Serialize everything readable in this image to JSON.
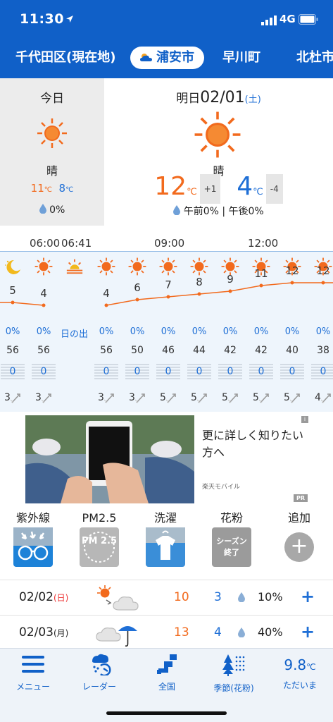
{
  "status_bar": {
    "time": "11:30",
    "network": "4G"
  },
  "tabs": [
    {
      "label": "千代田区(現在地)",
      "active": false
    },
    {
      "label": "浦安市",
      "active": true
    },
    {
      "label": "早川町",
      "active": false
    },
    {
      "label": "北杜市",
      "active": false
    }
  ],
  "today": {
    "label": "今日",
    "weather": "晴",
    "high": "11",
    "low": "8",
    "unit": "℃",
    "precip": "0%"
  },
  "tomorrow": {
    "label_prefix": "明日",
    "date": "02/01",
    "weekday": "(土)",
    "weather": "晴",
    "high": "12",
    "low": "4",
    "unit": "℃",
    "high_diff": "+1",
    "low_diff": "-4",
    "precip": "午前0% | 午後0%"
  },
  "hourly": {
    "time_labels": [
      "06:00",
      "06:41",
      "09:00",
      "12:00"
    ],
    "sunrise_label": "日の出",
    "columns": [
      {
        "icon": "moon-icon",
        "temp": "5",
        "precip": "0%",
        "humidity": "56",
        "rain": "0",
        "wind": "3"
      },
      {
        "icon": "sun-icon",
        "temp": "4",
        "precip": "0%",
        "humidity": "56",
        "rain": "0",
        "wind": "3"
      },
      {
        "icon": "sunrise-icon",
        "temp": "",
        "precip": "",
        "humidity": "",
        "rain": "",
        "wind": ""
      },
      {
        "icon": "sun-icon",
        "temp": "4",
        "precip": "0%",
        "humidity": "56",
        "rain": "0",
        "wind": "3"
      },
      {
        "icon": "sun-icon",
        "temp": "6",
        "precip": "0%",
        "humidity": "50",
        "rain": "0",
        "wind": "3"
      },
      {
        "icon": "sun-icon",
        "temp": "7",
        "precip": "0%",
        "humidity": "46",
        "rain": "0",
        "wind": "5"
      },
      {
        "icon": "sun-icon",
        "temp": "8",
        "precip": "0%",
        "humidity": "44",
        "rain": "0",
        "wind": "5"
      },
      {
        "icon": "sun-icon",
        "temp": "9",
        "precip": "0%",
        "humidity": "42",
        "rain": "0",
        "wind": "5"
      },
      {
        "icon": "sun-icon",
        "temp": "11",
        "precip": "0%",
        "humidity": "42",
        "rain": "0",
        "wind": "5"
      },
      {
        "icon": "sun-icon",
        "temp": "12",
        "precip": "0%",
        "humidity": "40",
        "rain": "0",
        "wind": "5"
      },
      {
        "icon": "sun-icon",
        "temp": "12",
        "precip": "0%",
        "humidity": "38",
        "rain": "0",
        "wind": "4"
      }
    ]
  },
  "ad": {
    "text": "更に詳しく知りたい方へ",
    "brand": "楽天モバイル",
    "pr": "PR",
    "info": "i"
  },
  "indices": [
    {
      "label": "紫外線",
      "icon": "uv-glasses-icon",
      "box_text": ""
    },
    {
      "label": "PM2.5",
      "icon": "pm25-icon",
      "box_text": "PM 2.5"
    },
    {
      "label": "洗濯",
      "icon": "laundry-shirt-icon",
      "box_text": ""
    },
    {
      "label": "花粉",
      "icon": "pollen-season-icon",
      "box_text": "シーズン 終了"
    },
    {
      "label": "追加",
      "icon": "add-circle-icon",
      "box_text": "+"
    }
  ],
  "daily": [
    {
      "date": "02/02",
      "weekday": "(日)",
      "icon": "sun-cloud-icon",
      "high": "10",
      "low": "3",
      "precip": "10%",
      "add": "+"
    },
    {
      "date": "02/03",
      "weekday": "(月)",
      "icon": "cloud-umbrella-icon",
      "high": "13",
      "low": "4",
      "precip": "40%",
      "add": "+"
    }
  ],
  "nav": [
    {
      "label": "メニュー",
      "icon": "menu-icon"
    },
    {
      "label": "レーダー",
      "icon": "radar-icon"
    },
    {
      "label": "全国",
      "icon": "japan-map-icon"
    },
    {
      "label": "季節(花粉)",
      "icon": "pollen-tree-icon"
    },
    {
      "label": "ただいま",
      "icon": "current-temp-icon",
      "value": "9.8",
      "unit": "℃"
    }
  ],
  "colors": {
    "brand_blue": "#1060c8",
    "high_orange": "#f26a1d",
    "low_blue": "#1f6fd6"
  }
}
